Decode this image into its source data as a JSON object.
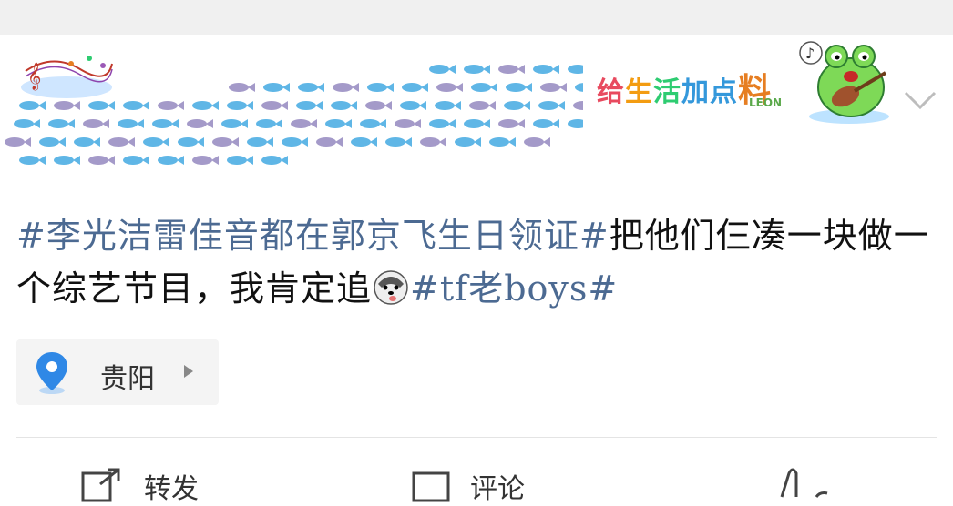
{
  "post": {
    "topic_tag_1": "#李光洁雷佳音都在郭京飞生日领证#",
    "text_part_1": "把他们仨凑一块做一个综艺节目，我肯定追",
    "emoji_name": "husky-dog-face-icon",
    "topic_tag_2": "#tf老boys#"
  },
  "location": {
    "label": "贵阳"
  },
  "brand_badge": {
    "chars": [
      "给",
      "生",
      "活",
      "加点",
      "料"
    ],
    "sub": "LEON"
  },
  "actions": {
    "repost_label": "转发",
    "comment_label": "评论"
  },
  "colors": {
    "topic_link": "#4c6a92",
    "text": "#111111",
    "location_pin": "#2f88e6"
  }
}
